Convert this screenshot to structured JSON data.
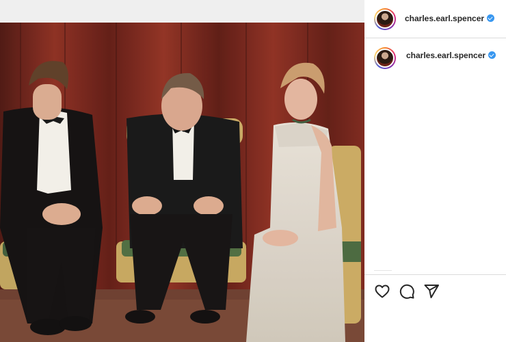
{
  "header": {
    "username": "charles.earl.spencer",
    "verified_icon": "verified-badge-icon"
  },
  "comment": {
    "username": "charles.earl.spencer",
    "verified_icon": "verified-badge-icon"
  },
  "actions": [
    {
      "name": "like-button",
      "icon": "heart-icon"
    },
    {
      "name": "comment-button",
      "icon": "comment-icon"
    },
    {
      "name": "share-button",
      "icon": "paper-plane-icon"
    }
  ],
  "colors": {
    "accent_verified": "#3897f0",
    "text": "#262626",
    "curtain": "#7a2418"
  }
}
